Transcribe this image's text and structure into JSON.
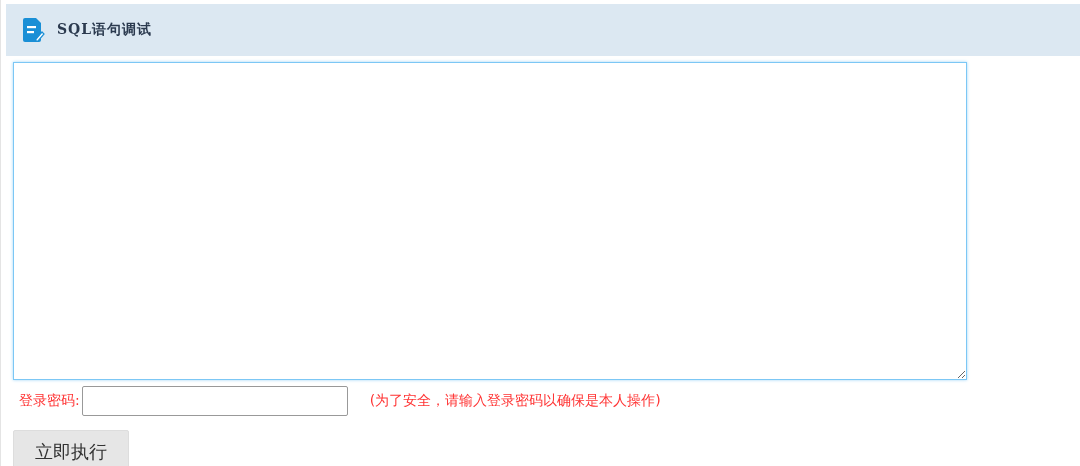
{
  "panel": {
    "title": "SQL语句调试"
  },
  "password": {
    "label": "登录密码:",
    "hint": "(为了安全，请输入登录密码以确保是本人操作)"
  },
  "buttons": [
    "立即执行"
  ]
}
